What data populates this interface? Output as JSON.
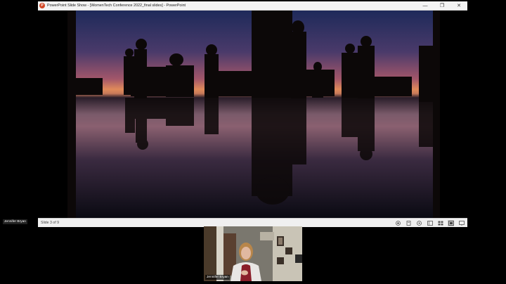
{
  "ppt_window": {
    "app_icon_letter": "P",
    "title": "PowerPoint Slide Show - [WomenTech Conference 2022_final slides] - PowerPoint",
    "controls": {
      "minimize": "—",
      "restore": "❐",
      "close": "✕"
    },
    "status": {
      "slide_counter": "Slide 3 of 9"
    }
  },
  "presenter": {
    "name_tag": "Jennifer Bryan"
  },
  "webcam": {
    "name_label": "Jennifer Bryan"
  },
  "colors": {
    "ppt_accent": "#d24726",
    "sky_top": "#1e2a5a",
    "sky_horizon": "#e08a5a"
  }
}
